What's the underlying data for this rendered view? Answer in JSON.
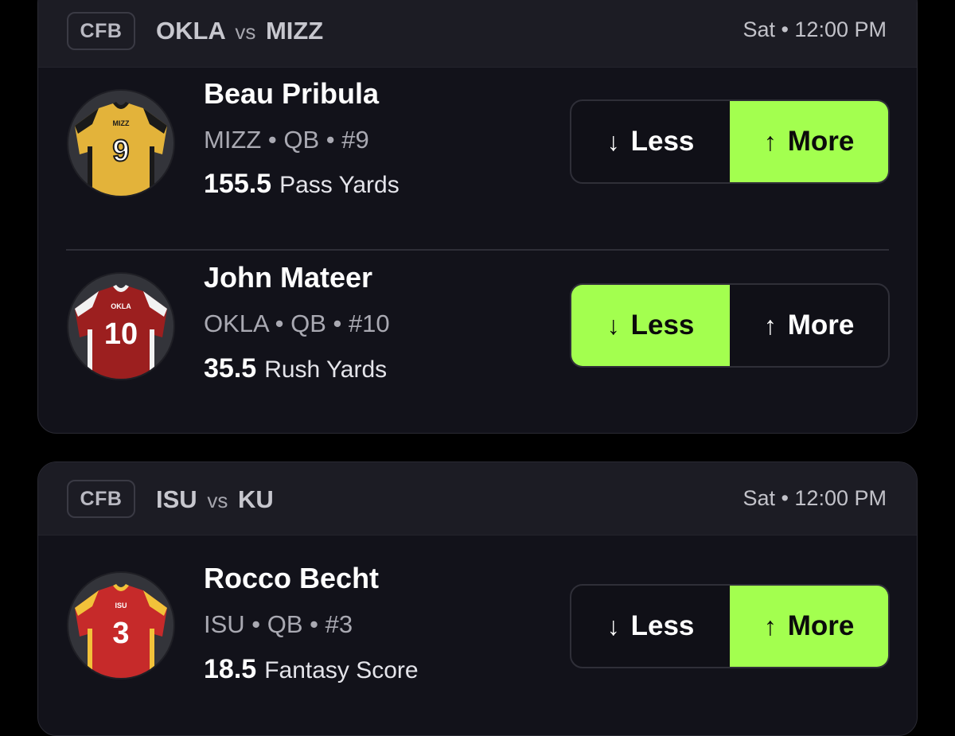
{
  "colors": {
    "background": "#000000",
    "card": "#12121a",
    "card_header": "#1c1c24",
    "accent_green": "#a3ff4f"
  },
  "games": [
    {
      "league": "CFB",
      "team_a": "OKLA",
      "vs": "vs",
      "team_b": "MIZZ",
      "time": "Sat • 12:00 PM",
      "props": [
        {
          "name": "Beau Pribula",
          "meta": "MIZZ • QB • #9",
          "line": "155.5",
          "stat": "Pass Yards",
          "jersey_number": "9",
          "jersey_label": "MIZZ",
          "jersey_color": "#e3b33a",
          "jersey_trim": "#1a1a1a",
          "selected": "more",
          "less_label": "Less",
          "more_label": "More",
          "less_icon": "arrow-down-icon",
          "more_icon": "arrow-up-icon"
        },
        {
          "name": "John Mateer",
          "meta": "OKLA • QB • #10",
          "line": "35.5",
          "stat": "Rush Yards",
          "jersey_number": "10",
          "jersey_label": "OKLA",
          "jersey_color": "#9c1f1f",
          "jersey_trim": "#f2f2f2",
          "selected": "less",
          "less_label": "Less",
          "more_label": "More",
          "less_icon": "arrow-down-icon",
          "more_icon": "arrow-up-icon"
        }
      ]
    },
    {
      "league": "CFB",
      "team_a": "ISU",
      "vs": "vs",
      "team_b": "KU",
      "time": "Sat • 12:00 PM",
      "props": [
        {
          "name": "Rocco Becht",
          "meta": "ISU • QB • #3",
          "line": "18.5",
          "stat": "Fantasy Score",
          "jersey_number": "3",
          "jersey_label": "ISU",
          "jersey_color": "#c62a2a",
          "jersey_trim": "#f2c23a",
          "selected": "more",
          "less_label": "Less",
          "more_label": "More",
          "less_icon": "arrow-down-icon",
          "more_icon": "arrow-up-icon"
        }
      ]
    }
  ]
}
